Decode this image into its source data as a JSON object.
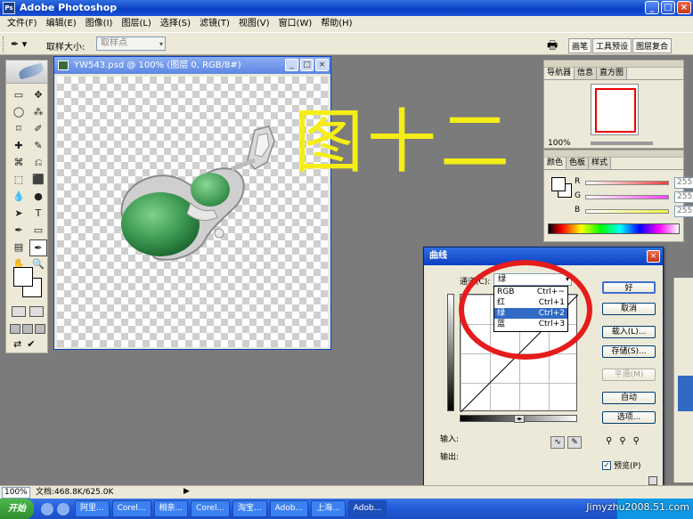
{
  "app": {
    "title": "Adobe Photoshop",
    "icon": "photoshop-icon",
    "icon_text": "Ps",
    "window_buttons": {
      "minimize": "_",
      "maximize": "□",
      "close": "×"
    }
  },
  "menu": [
    "文件(F)",
    "编辑(E)",
    "图像(I)",
    "图层(L)",
    "选择(S)",
    "滤镜(T)",
    "视图(V)",
    "窗口(W)",
    "帮助(H)"
  ],
  "options_bar": {
    "tool_icon": "eyedropper-icon",
    "tool_glyph": "✒ ▾",
    "sample_size_label": "取样大小:",
    "sample_size_value": "取样点",
    "select_arrow": "▾",
    "well_icon": "printer-icon",
    "well_glyph": "🖶",
    "well_tabs": [
      "画笔",
      "工具预设",
      "图层复合"
    ]
  },
  "tools": [
    "▭",
    "✥",
    "◯",
    "⁂",
    "⌑",
    "✐",
    "✚",
    "✎",
    "⌘",
    "⎌",
    "⬚",
    "⬛",
    "💧",
    "●",
    "➤",
    "T",
    "✒",
    "▭",
    "▤",
    "✒",
    "✋",
    "🔍"
  ],
  "document": {
    "title": "YW543.psd @ 100% (图层 0, RGB/8#)",
    "buttons": {
      "minimize": "_",
      "maximize": "□",
      "close": "×"
    }
  },
  "annotation_text": "图十二",
  "navigator": {
    "tabs": [
      "导航器",
      "信息",
      "直方图"
    ],
    "zoom": "100%"
  },
  "color_panel": {
    "tabs": [
      "颜色",
      "色板",
      "样式"
    ],
    "channels": [
      {
        "label": "R",
        "value": "255",
        "color": "#ff4040"
      },
      {
        "label": "G",
        "value": "255",
        "color": "#ff40ff"
      },
      {
        "label": "B",
        "value": "255",
        "color": "#f0f040"
      }
    ]
  },
  "curves_dialog": {
    "title": "曲线",
    "close": "×",
    "channel_label": "通道(C):",
    "channel_value": "绿",
    "select_arrow": "▾",
    "channel_options": [
      {
        "name": "RGB",
        "shortcut": "Ctrl+~",
        "selected": false
      },
      {
        "name": "红",
        "shortcut": "Ctrl+1",
        "selected": false
      },
      {
        "name": "绿",
        "shortcut": "Ctrl+2",
        "selected": true
      },
      {
        "name": "蓝",
        "shortcut": "Ctrl+3",
        "selected": false
      }
    ],
    "input_label": "输入:",
    "output_label": "输出:",
    "toggle_glyph": "◂▸",
    "curve_tools": {
      "curve": "∿",
      "pencil": "✎"
    },
    "eyedroppers": [
      "⚲",
      "⚲",
      "⚲"
    ],
    "buttons": {
      "ok": "好",
      "cancel": "取消",
      "load": "载入(L)...",
      "save": "存储(S)...",
      "smooth": "平滑(M)",
      "auto": "自动",
      "options": "选项..."
    },
    "preview_label": "预览(P)",
    "preview_checked": "✓"
  },
  "status": {
    "zoom": "100%",
    "doc_info": "文档:468.8K/625.0K",
    "arrow": "▶"
  },
  "taskbar": {
    "start": "开始",
    "items": [
      "阿里...",
      "Corel...",
      "相亲...",
      "Corel...",
      "淘宝...",
      "Adob...",
      "上海...",
      "Adob..."
    ],
    "watermark": "Jimyzhu2008.51.com"
  }
}
